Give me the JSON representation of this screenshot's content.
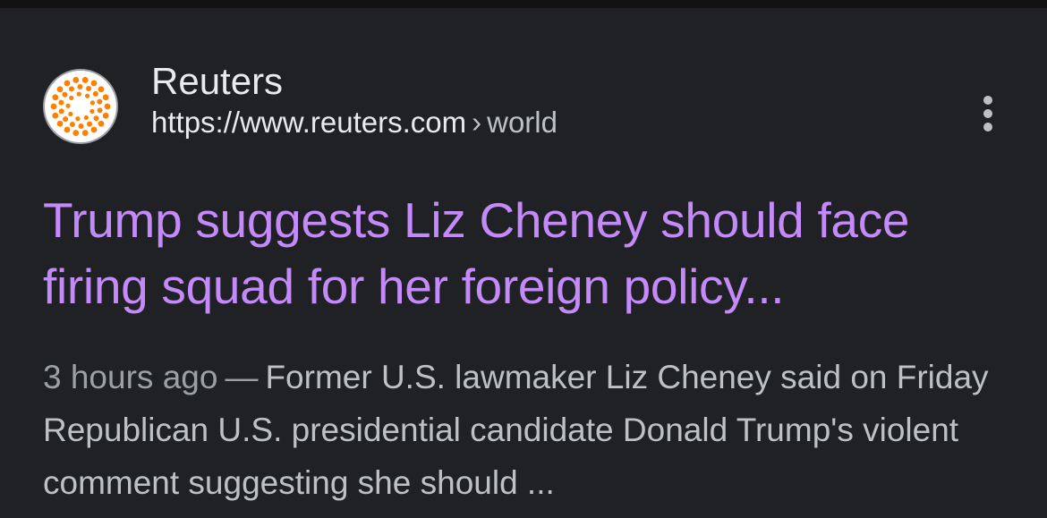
{
  "result": {
    "site_name": "Reuters",
    "url_base": "https://www.reuters.com",
    "url_separator": "›",
    "url_path": "world",
    "favicon_icon": "reuters-dot-ring-icon",
    "more_icon": "more-vertical-icon",
    "title": "Trump suggests Liz Cheney should face firing squad for her foreign policy...",
    "snippet_date": "3 hours ago",
    "snippet_dash": "—",
    "snippet_text": "Former U.S. lawmaker Liz Cheney said on Friday Republican U.S. presidential candidate Donald Trump's violent comment suggesting she should ..."
  },
  "colors": {
    "background": "#202124",
    "title_link": "#c58af9",
    "primary_text": "#e8eaed",
    "secondary_text": "#bdc1c6",
    "reuters_orange": "#ff8000"
  }
}
